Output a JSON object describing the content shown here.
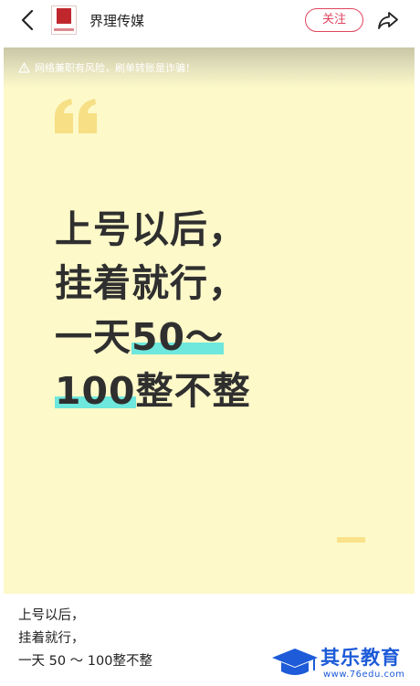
{
  "header": {
    "back_icon": "chevron-left-icon",
    "logo_text": "界理传媒",
    "account_name": "界理传媒",
    "follow_label": "关注",
    "share_icon": "share-arrow-icon"
  },
  "post": {
    "warning": "网络兼职有风险，刷单转账是诈骗！",
    "warning_icon": "warning-triangle-icon",
    "quote_icon": "quote-mark-icon",
    "quote_color": "#f6df84",
    "highlight_color": "#6ee7dc",
    "background_color": "#fdf9c9",
    "headline": {
      "line1": "上号以后，",
      "line2": "挂着就行，",
      "line3_prefix": "一天",
      "line3_highlight": "50～",
      "line4_highlight": "100",
      "line4_suffix": "整不整"
    }
  },
  "caption": {
    "line1": "上号以后，",
    "line2": "挂着就行，",
    "line3": "一天 50 ～ 100整不整"
  },
  "watermark": {
    "name": "其乐教育",
    "url": "www.76edu.com",
    "icon": "graduation-cap-icon",
    "color": "#1d5bd8"
  }
}
